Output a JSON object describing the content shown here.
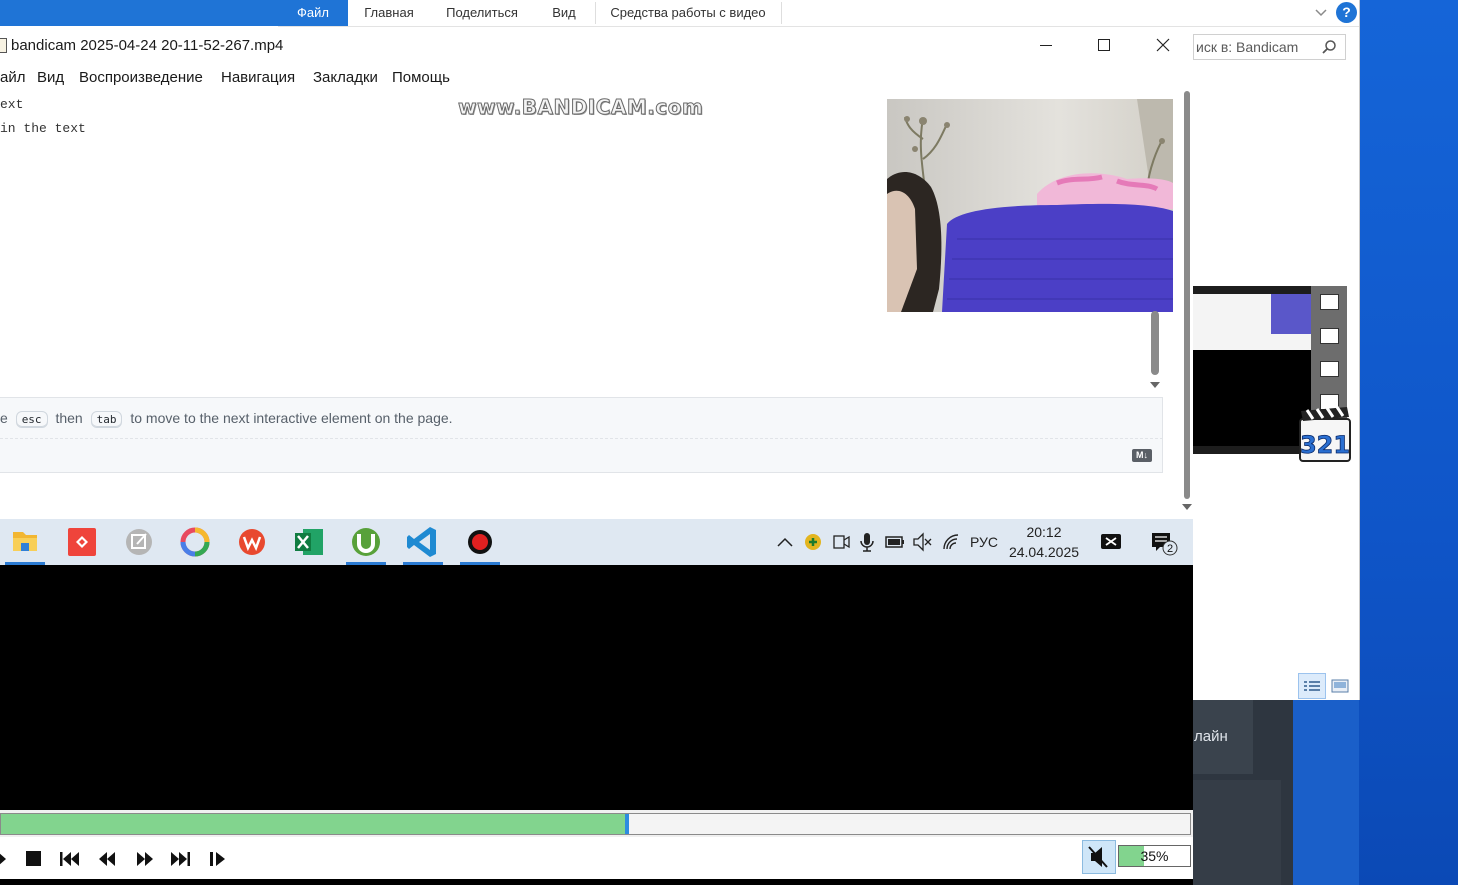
{
  "explorer": {
    "ribbon_tabs": [
      "Файл",
      "Главная",
      "Поделиться",
      "Вид",
      "Средства работы с видео"
    ],
    "active_tab": "Файл",
    "search_placeholder": "иск в: Bandicam",
    "help_label": "?"
  },
  "desktop": {
    "card_label": "лайн"
  },
  "thumbnail": {
    "badge_text": "321"
  },
  "player": {
    "title": "bandicam 2025-04-24 20-11-52-267.mp4",
    "menu": [
      "айл",
      "Вид",
      "Воспроизведение",
      "Навигация",
      "Закладки",
      "Помощь"
    ],
    "seek_progress": 0.525,
    "volume_percent": 35,
    "volume_label": "35%"
  },
  "recording": {
    "watermark": "www.BANDICAM.com",
    "code_lines": [
      "ext",
      "in the text"
    ],
    "hint": {
      "prefix": "e",
      "key1": "esc",
      "middle": "then",
      "key2": "tab",
      "suffix": "to move to the next interactive element on the page."
    },
    "md_badge": "M↓",
    "taskbar": {
      "tray_language": "РУС",
      "time": "20:12",
      "date": "24.04.2025",
      "notification_count": "2"
    }
  },
  "colors": {
    "accent_blue": "#1f74d6",
    "seek_green": "#82d48e",
    "seek_handle": "#2d8ce0"
  }
}
